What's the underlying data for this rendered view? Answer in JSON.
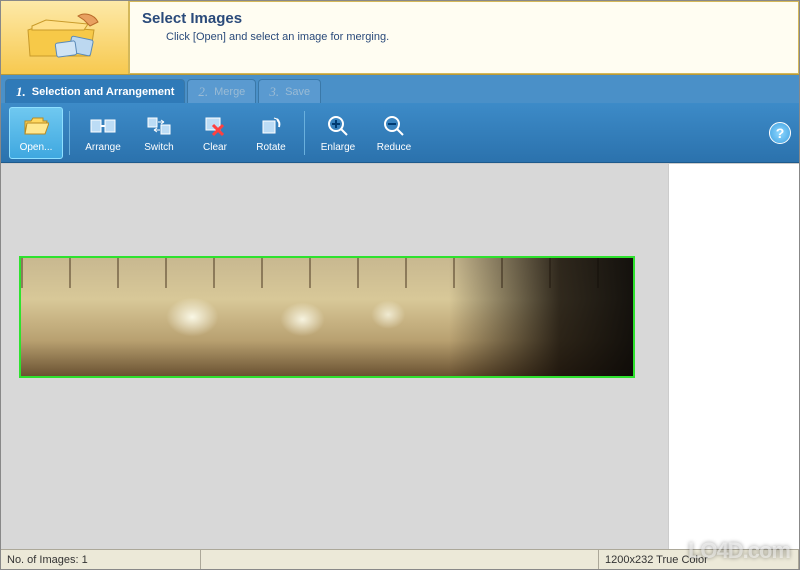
{
  "banner": {
    "title": "Select Images",
    "subtitle": "Click [Open] and select an image for merging."
  },
  "tabs": [
    {
      "num": "1.",
      "label": "Selection and Arrangement",
      "active": true,
      "disabled": false
    },
    {
      "num": "2.",
      "label": "Merge",
      "active": false,
      "disabled": true
    },
    {
      "num": "3.",
      "label": "Save",
      "active": false,
      "disabled": true
    }
  ],
  "toolbar": {
    "open": "Open...",
    "arrange": "Arrange",
    "switch": "Switch",
    "clear": "Clear",
    "rotate": "Rotate",
    "enlarge": "Enlarge",
    "reduce": "Reduce",
    "help": "?"
  },
  "status": {
    "images_label": "No. of Images: 1",
    "image_info": "1200x232 True Color"
  },
  "watermark": "LO4D.com"
}
